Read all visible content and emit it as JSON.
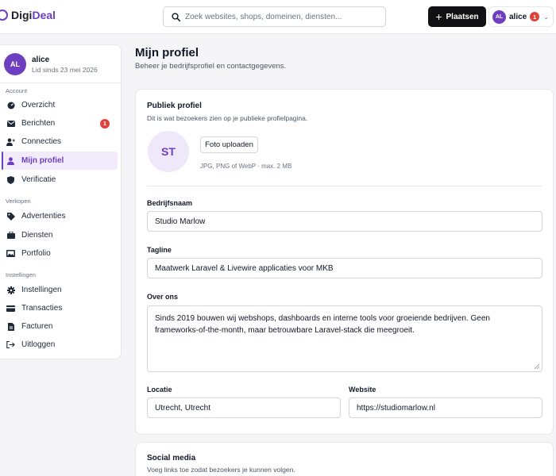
{
  "brand": {
    "name_first": "Digi",
    "name_second": "Deal"
  },
  "search": {
    "placeholder": "Zoek websites, shops, domeinen, diensten..."
  },
  "header": {
    "place_label": "Plaatsen",
    "user_initials": "AL",
    "user_name": "alice",
    "notification_count": "1"
  },
  "sidebar": {
    "user": {
      "initials": "AL",
      "name": "alice",
      "member_since": "Lid sinds 23 mei 2026"
    },
    "sections": [
      {
        "label": "Account",
        "items": [
          {
            "label": "Overzicht",
            "icon": "dashboard-icon"
          },
          {
            "label": "Berichten",
            "icon": "envelope-icon",
            "badge": "1"
          },
          {
            "label": "Connecties",
            "icon": "user-plus-icon"
          },
          {
            "label": "Mijn profiel",
            "icon": "user-icon",
            "active": true
          },
          {
            "label": "Verificatie",
            "icon": "shield-icon"
          }
        ]
      },
      {
        "label": "Verkopen",
        "items": [
          {
            "label": "Advertenties",
            "icon": "tag-icon"
          },
          {
            "label": "Diensten",
            "icon": "briefcase-icon"
          },
          {
            "label": "Portfolio",
            "icon": "images-icon"
          }
        ]
      },
      {
        "label": "Instellingen",
        "items": [
          {
            "label": "Instellingen",
            "icon": "gear-icon"
          },
          {
            "label": "Transacties",
            "icon": "credit-card-icon"
          },
          {
            "label": "Facturen",
            "icon": "invoice-icon"
          },
          {
            "label": "Uitloggen",
            "icon": "logout-icon"
          }
        ]
      }
    ]
  },
  "page": {
    "title": "Mijn profiel",
    "subtitle": "Beheer je bedrijfsprofiel en contactgegevens."
  },
  "public_profile": {
    "title": "Publiek profiel",
    "subtitle": "Dit is wat bezoekers zien op je publieke profielpagina.",
    "avatar_initials": "ST",
    "upload_label": "Foto uploaden",
    "upload_hint": "JPG, PNG of WebP · max. 2 MB"
  },
  "form": {
    "company_label": "Bedrijfsnaam",
    "company_value": "Studio Marlow",
    "tagline_label": "Tagline",
    "tagline_value": "Maatwerk Laravel & Livewire applicaties voor MKB",
    "about_label": "Over ons",
    "about_value": "Sinds 2019 bouwen wij webshops, dashboards en interne tools voor groeiende bedrijven. Geen frameworks-of-the-month, maar betrouwbare Laravel-stack die meegroeit.",
    "location_label": "Locatie",
    "location_value": "Utrecht, Utrecht",
    "website_label": "Website",
    "website_value": "https://studiomarlow.nl"
  },
  "social": {
    "title": "Social media",
    "subtitle": "Voeg links toe zodat bezoekers je kunnen volgen."
  },
  "colors": {
    "accent": "#6d3fc0",
    "badge": "#e0413a"
  }
}
